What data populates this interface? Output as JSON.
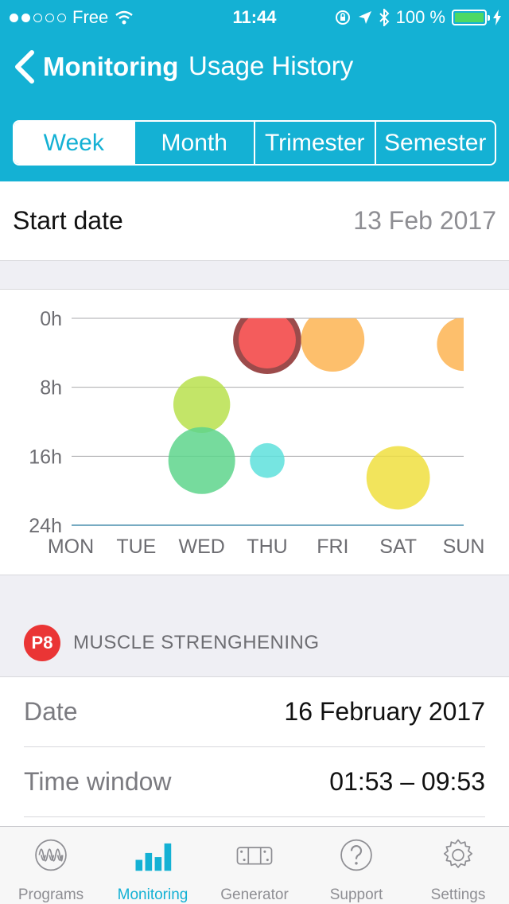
{
  "status_bar": {
    "carrier": "Free",
    "time": "11:44",
    "battery": "100 %",
    "signal_dots_filled": 2,
    "signal_dots_total": 5
  },
  "nav": {
    "back_label": "Monitoring",
    "title": "Usage History"
  },
  "segments": [
    "Week",
    "Month",
    "Trimester",
    "Semester"
  ],
  "active_segment": "Week",
  "start_date": {
    "label": "Start date",
    "value": "13 Feb 2017"
  },
  "chart_data": {
    "type": "scatter",
    "days": [
      "MON",
      "TUE",
      "WED",
      "THU",
      "FRI",
      "SAT",
      "SUN"
    ],
    "y_tick_labels": [
      "0h",
      "8h",
      "16h",
      "24h"
    ],
    "ylim": [
      0,
      24
    ],
    "y_direction": "downward",
    "points": [
      {
        "day": "WED",
        "hour": 10,
        "size": 0.85,
        "color": "#b8e04e"
      },
      {
        "day": "WED",
        "hour": 16.5,
        "size": 1.0,
        "color": "#5ed58c"
      },
      {
        "day": "THU",
        "hour": 2.5,
        "size": 0.95,
        "color": "#fe5e5e",
        "selected": true
      },
      {
        "day": "THU",
        "hour": 16.5,
        "size": 0.52,
        "color": "#5ee0dc"
      },
      {
        "day": "FRI",
        "hour": 2.5,
        "size": 0.95,
        "color": "#fdb452"
      },
      {
        "day": "SAT",
        "hour": 18.5,
        "size": 0.95,
        "color": "#f0df3f"
      },
      {
        "day": "SUN",
        "hour": 3,
        "size": 0.8,
        "color": "#fdb452"
      }
    ]
  },
  "program": {
    "badge": "P8",
    "name": "MUSCLE STRENGHENING",
    "badge_color": "#ea3535"
  },
  "details": [
    {
      "label": "Date",
      "value": "16 February 2017"
    },
    {
      "label": "Time window",
      "value": "01:53 – 09:53"
    }
  ],
  "tabs": [
    {
      "label": "Programs",
      "icon": "programs-wave-icon"
    },
    {
      "label": "Monitoring",
      "icon": "monitoring-bars-icon"
    },
    {
      "label": "Generator",
      "icon": "generator-device-icon"
    },
    {
      "label": "Support",
      "icon": "question-circle-icon"
    },
    {
      "label": "Settings",
      "icon": "gear-icon"
    }
  ],
  "active_tab": "Monitoring",
  "colors": {
    "accent": "#14b1d4",
    "background": "#efeff4"
  }
}
